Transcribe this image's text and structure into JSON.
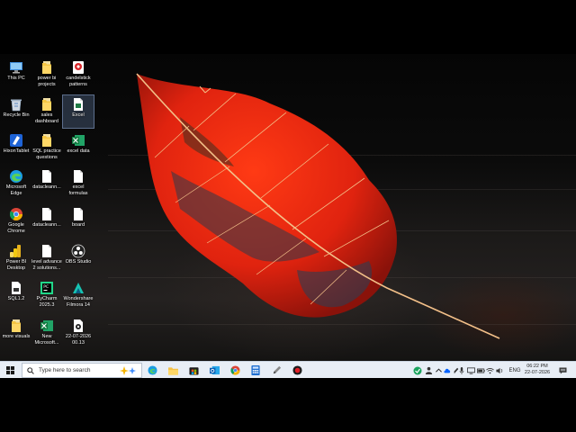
{
  "desktop_icons": [
    {
      "name": "icon-this-pc",
      "icon": "computer-icon",
      "line1": "This PC",
      "line2": ""
    },
    {
      "name": "icon-power-bi-projects",
      "icon": "folder-icon",
      "line1": "power bi",
      "line2": "projects"
    },
    {
      "name": "icon-candelstick-patterns",
      "icon": "app-shortcut-icon",
      "line1": "candelstick",
      "line2": "patterns"
    },
    {
      "name": "icon-recycle-bin",
      "icon": "recycle-bin-icon",
      "line1": "Recycle Bin",
      "line2": ""
    },
    {
      "name": "icon-sales-dashboard",
      "icon": "folder-icon",
      "line1": "sales",
      "line2": "dashboard"
    },
    {
      "name": "icon-excel",
      "icon": "document-icon",
      "line1": "Excel",
      "line2": ""
    },
    {
      "name": "icon-hixon-tablet",
      "icon": "hixon-tablet-icon",
      "line1": "HixonTablet",
      "line2": ""
    },
    {
      "name": "icon-sql-practice-questions",
      "icon": "folder-icon",
      "line1": "SQL practice",
      "line2": "questions"
    },
    {
      "name": "icon-excel-data",
      "icon": "excel-icon",
      "line1": "excel data",
      "line2": ""
    },
    {
      "name": "icon-microsoft-edge",
      "icon": "edge-icon",
      "line1": "Microsoft",
      "line2": "Edge"
    },
    {
      "name": "icon-datacleaning-1",
      "icon": "blank-file-icon",
      "line1": "datacleann...",
      "line2": ""
    },
    {
      "name": "icon-excel-formulas",
      "icon": "blank-file-icon",
      "line1": "excel",
      "line2": "formulas"
    },
    {
      "name": "icon-google-chrome",
      "icon": "chrome-icon",
      "line1": "Google",
      "line2": "Chrome"
    },
    {
      "name": "icon-datacleaning-2",
      "icon": "blank-file-icon",
      "line1": "datacleann...",
      "line2": ""
    },
    {
      "name": "icon-board",
      "icon": "blank-file-icon",
      "line1": "board",
      "line2": ""
    },
    {
      "name": "icon-power-bi-desktop",
      "icon": "power-bi-icon",
      "line1": "Power BI",
      "line2": "Desktop"
    },
    {
      "name": "icon-level-advance-solutions",
      "icon": "blank-file-icon",
      "line1": "level advance",
      "line2": "2 solutions..."
    },
    {
      "name": "icon-obs-studio",
      "icon": "obs-icon",
      "line1": "OBS Studio",
      "line2": ""
    },
    {
      "name": "icon-sql-1-2",
      "icon": "sql-file-icon",
      "line1": "SQL1.2",
      "line2": ""
    },
    {
      "name": "icon-pycharm",
      "icon": "pycharm-icon",
      "line1": "PyCharm",
      "line2": "2025.3"
    },
    {
      "name": "icon-wondershare-filmora",
      "icon": "filmora-icon",
      "line1": "Wondershare",
      "line2": "Filmora 14"
    },
    {
      "name": "icon-more-visuals",
      "icon": "folder-icon",
      "line1": "more visuals",
      "line2": ""
    },
    {
      "name": "icon-new-microsoft",
      "icon": "excel-icon",
      "line1": "New",
      "line2": "Microsoft..."
    },
    {
      "name": "icon-video-file",
      "icon": "video-file-icon",
      "line1": "22-07-2026",
      "line2": "00.13"
    }
  ],
  "taskbar": {
    "search_placeholder": "Type here to search",
    "pinned_apps": [
      {
        "name": "taskbar-edge",
        "icon": "edge-icon"
      },
      {
        "name": "taskbar-file-explorer",
        "icon": "folder-icon"
      },
      {
        "name": "taskbar-store",
        "icon": "store-icon"
      },
      {
        "name": "taskbar-outlook",
        "icon": "mail-icon"
      },
      {
        "name": "taskbar-chrome",
        "icon": "chrome-icon"
      },
      {
        "name": "taskbar-calculator",
        "icon": "calculator-icon"
      },
      {
        "name": "taskbar-pen-app",
        "icon": "pen-icon"
      },
      {
        "name": "taskbar-recorder",
        "icon": "record-icon"
      }
    ],
    "tray": {
      "language": "ENG",
      "time": "06:22 PM",
      "date": "22-07-2026"
    }
  },
  "colors": {
    "taskbar_bg": "#e8eef6",
    "leaf_red": "#e0230f",
    "leaf_vein": "#f3c089",
    "desktop_bg": "#0a0a0a"
  }
}
